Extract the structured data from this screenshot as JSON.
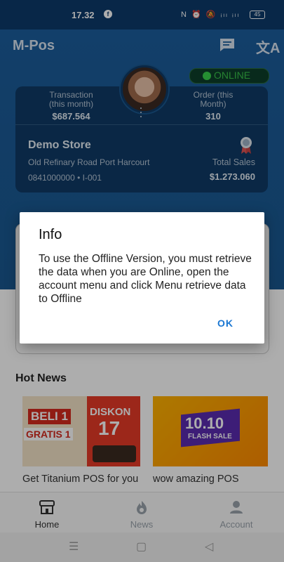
{
  "status_bar": {
    "time": "17.32",
    "battery": "45",
    "icons": [
      "nfc-icon",
      "alarm-icon",
      "mute-icon",
      "signal-4g-icon",
      "signal-icon"
    ]
  },
  "header": {
    "app_title": "M-Pos",
    "chat_icon": "chat-icon",
    "translate_icon": "translate-icon",
    "online_label": "ONLINE"
  },
  "summary": {
    "transaction_label": "Transaction (this month)",
    "transaction_value": "$687.564",
    "order_label": "Order (this Month)",
    "order_value": "310"
  },
  "store": {
    "name": "Demo Store",
    "address": "Old Refinary Road Port Harcourt",
    "contact": "0841000000 • I-001",
    "sales_label": "Total Sales",
    "sales_value": "$1.273.060"
  },
  "hot_news": {
    "heading": "Hot News",
    "items": [
      {
        "title": "Get Titanium POS for you",
        "image_text": [
          "BELI 1",
          "GRATIS 1",
          "DISKON",
          "17"
        ]
      },
      {
        "title": "wow amazing POS",
        "image_text": [
          "10.10",
          "FLASH SALE"
        ]
      }
    ]
  },
  "bottom_nav": [
    {
      "label": "Home",
      "icon": "home-icon",
      "active": true
    },
    {
      "label": "News",
      "icon": "news-icon",
      "active": false
    },
    {
      "label": "Account",
      "icon": "account-icon",
      "active": false
    }
  ],
  "dialog": {
    "title": "Info",
    "message": "To use the Offline Version, you must retrieve the data when you are Online, open the account menu and click Menu retrieve data to Offline",
    "ok_label": "OK"
  },
  "colors": {
    "header_blue": "#1b5d9c",
    "card_navy": "#0f3a66",
    "online_green": "#37d24b",
    "accent_blue": "#1976d2"
  }
}
